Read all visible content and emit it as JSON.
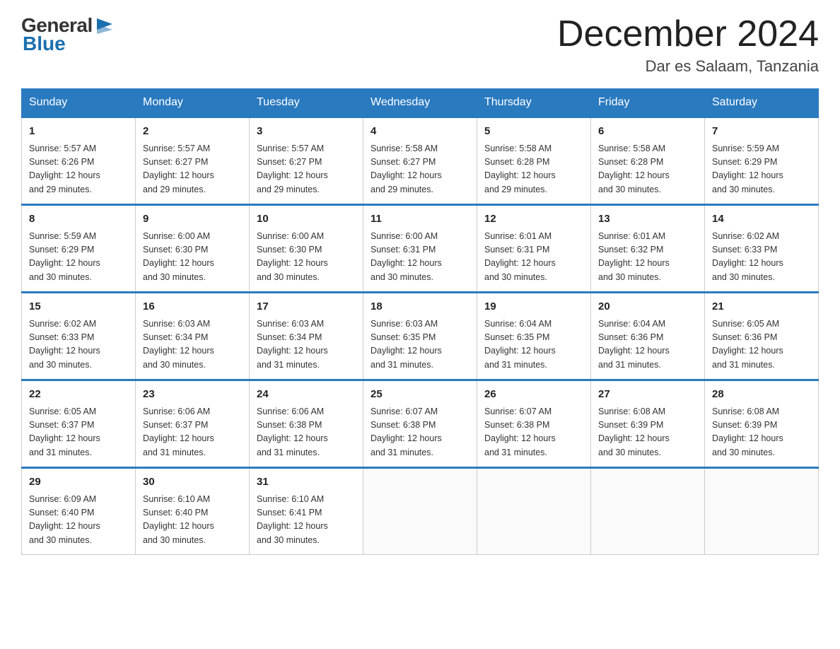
{
  "logo": {
    "general": "General",
    "blue": "Blue"
  },
  "header": {
    "title": "December 2024",
    "location": "Dar es Salaam, Tanzania"
  },
  "weekdays": [
    "Sunday",
    "Monday",
    "Tuesday",
    "Wednesday",
    "Thursday",
    "Friday",
    "Saturday"
  ],
  "weeks": [
    [
      {
        "day": "1",
        "sunrise": "5:57 AM",
        "sunset": "6:26 PM",
        "daylight": "12 hours and 29 minutes."
      },
      {
        "day": "2",
        "sunrise": "5:57 AM",
        "sunset": "6:27 PM",
        "daylight": "12 hours and 29 minutes."
      },
      {
        "day": "3",
        "sunrise": "5:57 AM",
        "sunset": "6:27 PM",
        "daylight": "12 hours and 29 minutes."
      },
      {
        "day": "4",
        "sunrise": "5:58 AM",
        "sunset": "6:27 PM",
        "daylight": "12 hours and 29 minutes."
      },
      {
        "day": "5",
        "sunrise": "5:58 AM",
        "sunset": "6:28 PM",
        "daylight": "12 hours and 29 minutes."
      },
      {
        "day": "6",
        "sunrise": "5:58 AM",
        "sunset": "6:28 PM",
        "daylight": "12 hours and 30 minutes."
      },
      {
        "day": "7",
        "sunrise": "5:59 AM",
        "sunset": "6:29 PM",
        "daylight": "12 hours and 30 minutes."
      }
    ],
    [
      {
        "day": "8",
        "sunrise": "5:59 AM",
        "sunset": "6:29 PM",
        "daylight": "12 hours and 30 minutes."
      },
      {
        "day": "9",
        "sunrise": "6:00 AM",
        "sunset": "6:30 PM",
        "daylight": "12 hours and 30 minutes."
      },
      {
        "day": "10",
        "sunrise": "6:00 AM",
        "sunset": "6:30 PM",
        "daylight": "12 hours and 30 minutes."
      },
      {
        "day": "11",
        "sunrise": "6:00 AM",
        "sunset": "6:31 PM",
        "daylight": "12 hours and 30 minutes."
      },
      {
        "day": "12",
        "sunrise": "6:01 AM",
        "sunset": "6:31 PM",
        "daylight": "12 hours and 30 minutes."
      },
      {
        "day": "13",
        "sunrise": "6:01 AM",
        "sunset": "6:32 PM",
        "daylight": "12 hours and 30 minutes."
      },
      {
        "day": "14",
        "sunrise": "6:02 AM",
        "sunset": "6:33 PM",
        "daylight": "12 hours and 30 minutes."
      }
    ],
    [
      {
        "day": "15",
        "sunrise": "6:02 AM",
        "sunset": "6:33 PM",
        "daylight": "12 hours and 30 minutes."
      },
      {
        "day": "16",
        "sunrise": "6:03 AM",
        "sunset": "6:34 PM",
        "daylight": "12 hours and 30 minutes."
      },
      {
        "day": "17",
        "sunrise": "6:03 AM",
        "sunset": "6:34 PM",
        "daylight": "12 hours and 31 minutes."
      },
      {
        "day": "18",
        "sunrise": "6:03 AM",
        "sunset": "6:35 PM",
        "daylight": "12 hours and 31 minutes."
      },
      {
        "day": "19",
        "sunrise": "6:04 AM",
        "sunset": "6:35 PM",
        "daylight": "12 hours and 31 minutes."
      },
      {
        "day": "20",
        "sunrise": "6:04 AM",
        "sunset": "6:36 PM",
        "daylight": "12 hours and 31 minutes."
      },
      {
        "day": "21",
        "sunrise": "6:05 AM",
        "sunset": "6:36 PM",
        "daylight": "12 hours and 31 minutes."
      }
    ],
    [
      {
        "day": "22",
        "sunrise": "6:05 AM",
        "sunset": "6:37 PM",
        "daylight": "12 hours and 31 minutes."
      },
      {
        "day": "23",
        "sunrise": "6:06 AM",
        "sunset": "6:37 PM",
        "daylight": "12 hours and 31 minutes."
      },
      {
        "day": "24",
        "sunrise": "6:06 AM",
        "sunset": "6:38 PM",
        "daylight": "12 hours and 31 minutes."
      },
      {
        "day": "25",
        "sunrise": "6:07 AM",
        "sunset": "6:38 PM",
        "daylight": "12 hours and 31 minutes."
      },
      {
        "day": "26",
        "sunrise": "6:07 AM",
        "sunset": "6:38 PM",
        "daylight": "12 hours and 31 minutes."
      },
      {
        "day": "27",
        "sunrise": "6:08 AM",
        "sunset": "6:39 PM",
        "daylight": "12 hours and 30 minutes."
      },
      {
        "day": "28",
        "sunrise": "6:08 AM",
        "sunset": "6:39 PM",
        "daylight": "12 hours and 30 minutes."
      }
    ],
    [
      {
        "day": "29",
        "sunrise": "6:09 AM",
        "sunset": "6:40 PM",
        "daylight": "12 hours and 30 minutes."
      },
      {
        "day": "30",
        "sunrise": "6:10 AM",
        "sunset": "6:40 PM",
        "daylight": "12 hours and 30 minutes."
      },
      {
        "day": "31",
        "sunrise": "6:10 AM",
        "sunset": "6:41 PM",
        "daylight": "12 hours and 30 minutes."
      },
      null,
      null,
      null,
      null
    ]
  ],
  "labels": {
    "sunrise": "Sunrise:",
    "sunset": "Sunset:",
    "daylight": "Daylight:"
  }
}
